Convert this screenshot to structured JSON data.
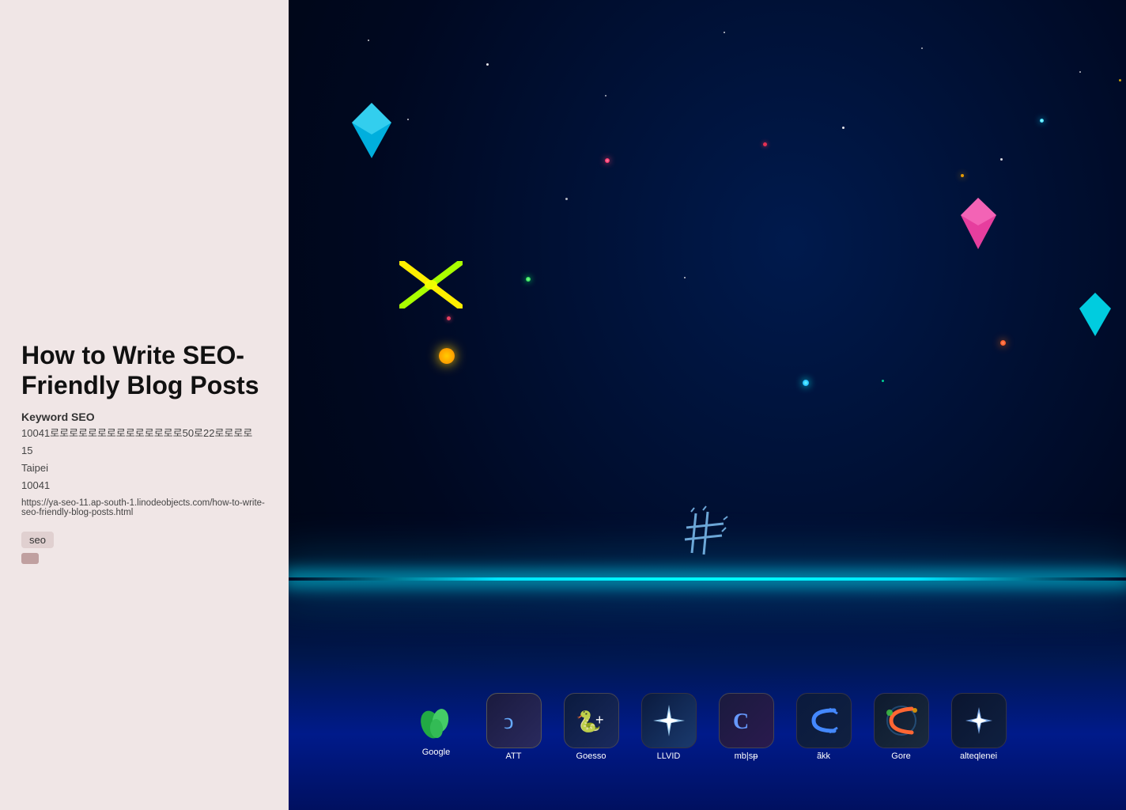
{
  "left_panel": {
    "title": "How to Write SEO-Friendly Blog Posts",
    "meta": {
      "keyword_label": "Keyword SEO",
      "address_line": "10041로로로로로로로로로로로로로로50로22로로로로",
      "number": "15",
      "city": "Taipei",
      "postal": "10041",
      "url": "https://ya-seo-11.ap-south-1.linodeobjects.com/how-to-write-seo-friendly-blog-posts.html"
    },
    "tags": [
      "seo"
    ]
  },
  "right_panel": {
    "app_dock": {
      "apps": [
        {
          "id": "google",
          "label": "Google",
          "symbol": "🌿"
        },
        {
          "id": "att",
          "label": "ATT",
          "symbol": "ↄ"
        },
        {
          "id": "goesso",
          "label": "Goesso",
          "symbol": "🐍+"
        },
        {
          "id": "llvid",
          "label": "LLVID",
          "symbol": "✦"
        },
        {
          "id": "mb",
          "label": "mb|sᵽ",
          "symbol": "C"
        },
        {
          "id": "akk",
          "label": "ãkk",
          "symbol": "C"
        },
        {
          "id": "gore",
          "label": "Gore",
          "symbol": "🌐"
        },
        {
          "id": "alteqlenei",
          "label": "alteqlenei",
          "symbol": "✦"
        }
      ]
    }
  }
}
